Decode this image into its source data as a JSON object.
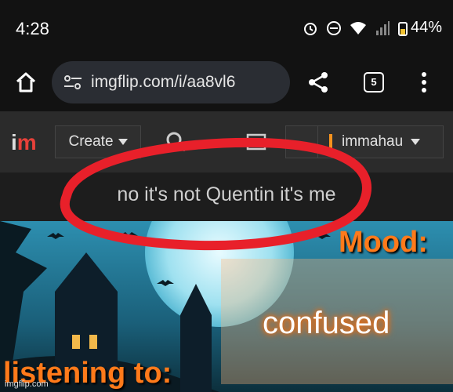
{
  "status": {
    "time": "4:28",
    "battery": "44%"
  },
  "browser": {
    "url": "imgflip.com/i/aa8vl6",
    "tab_count": "5"
  },
  "imgflip": {
    "create_label": "Create",
    "username": "immahau"
  },
  "meme": {
    "title": "no it's not Quentin it's me",
    "mood_label": "Mood:",
    "mood_value": "confused",
    "listening_label": "listening to:",
    "watermark": "imgflip.com"
  },
  "colors": {
    "accent_orange": "#ff7a1a",
    "annotation_red": "#e8202a",
    "brand_red": "#e8413a"
  },
  "icons": [
    "alarm-icon",
    "dnd-icon",
    "wifi-icon",
    "signal-icon",
    "battery-icon",
    "home-icon",
    "tune-icon",
    "share-icon",
    "tabs-icon",
    "menu-icon",
    "search-icon",
    "upload-icon"
  ]
}
